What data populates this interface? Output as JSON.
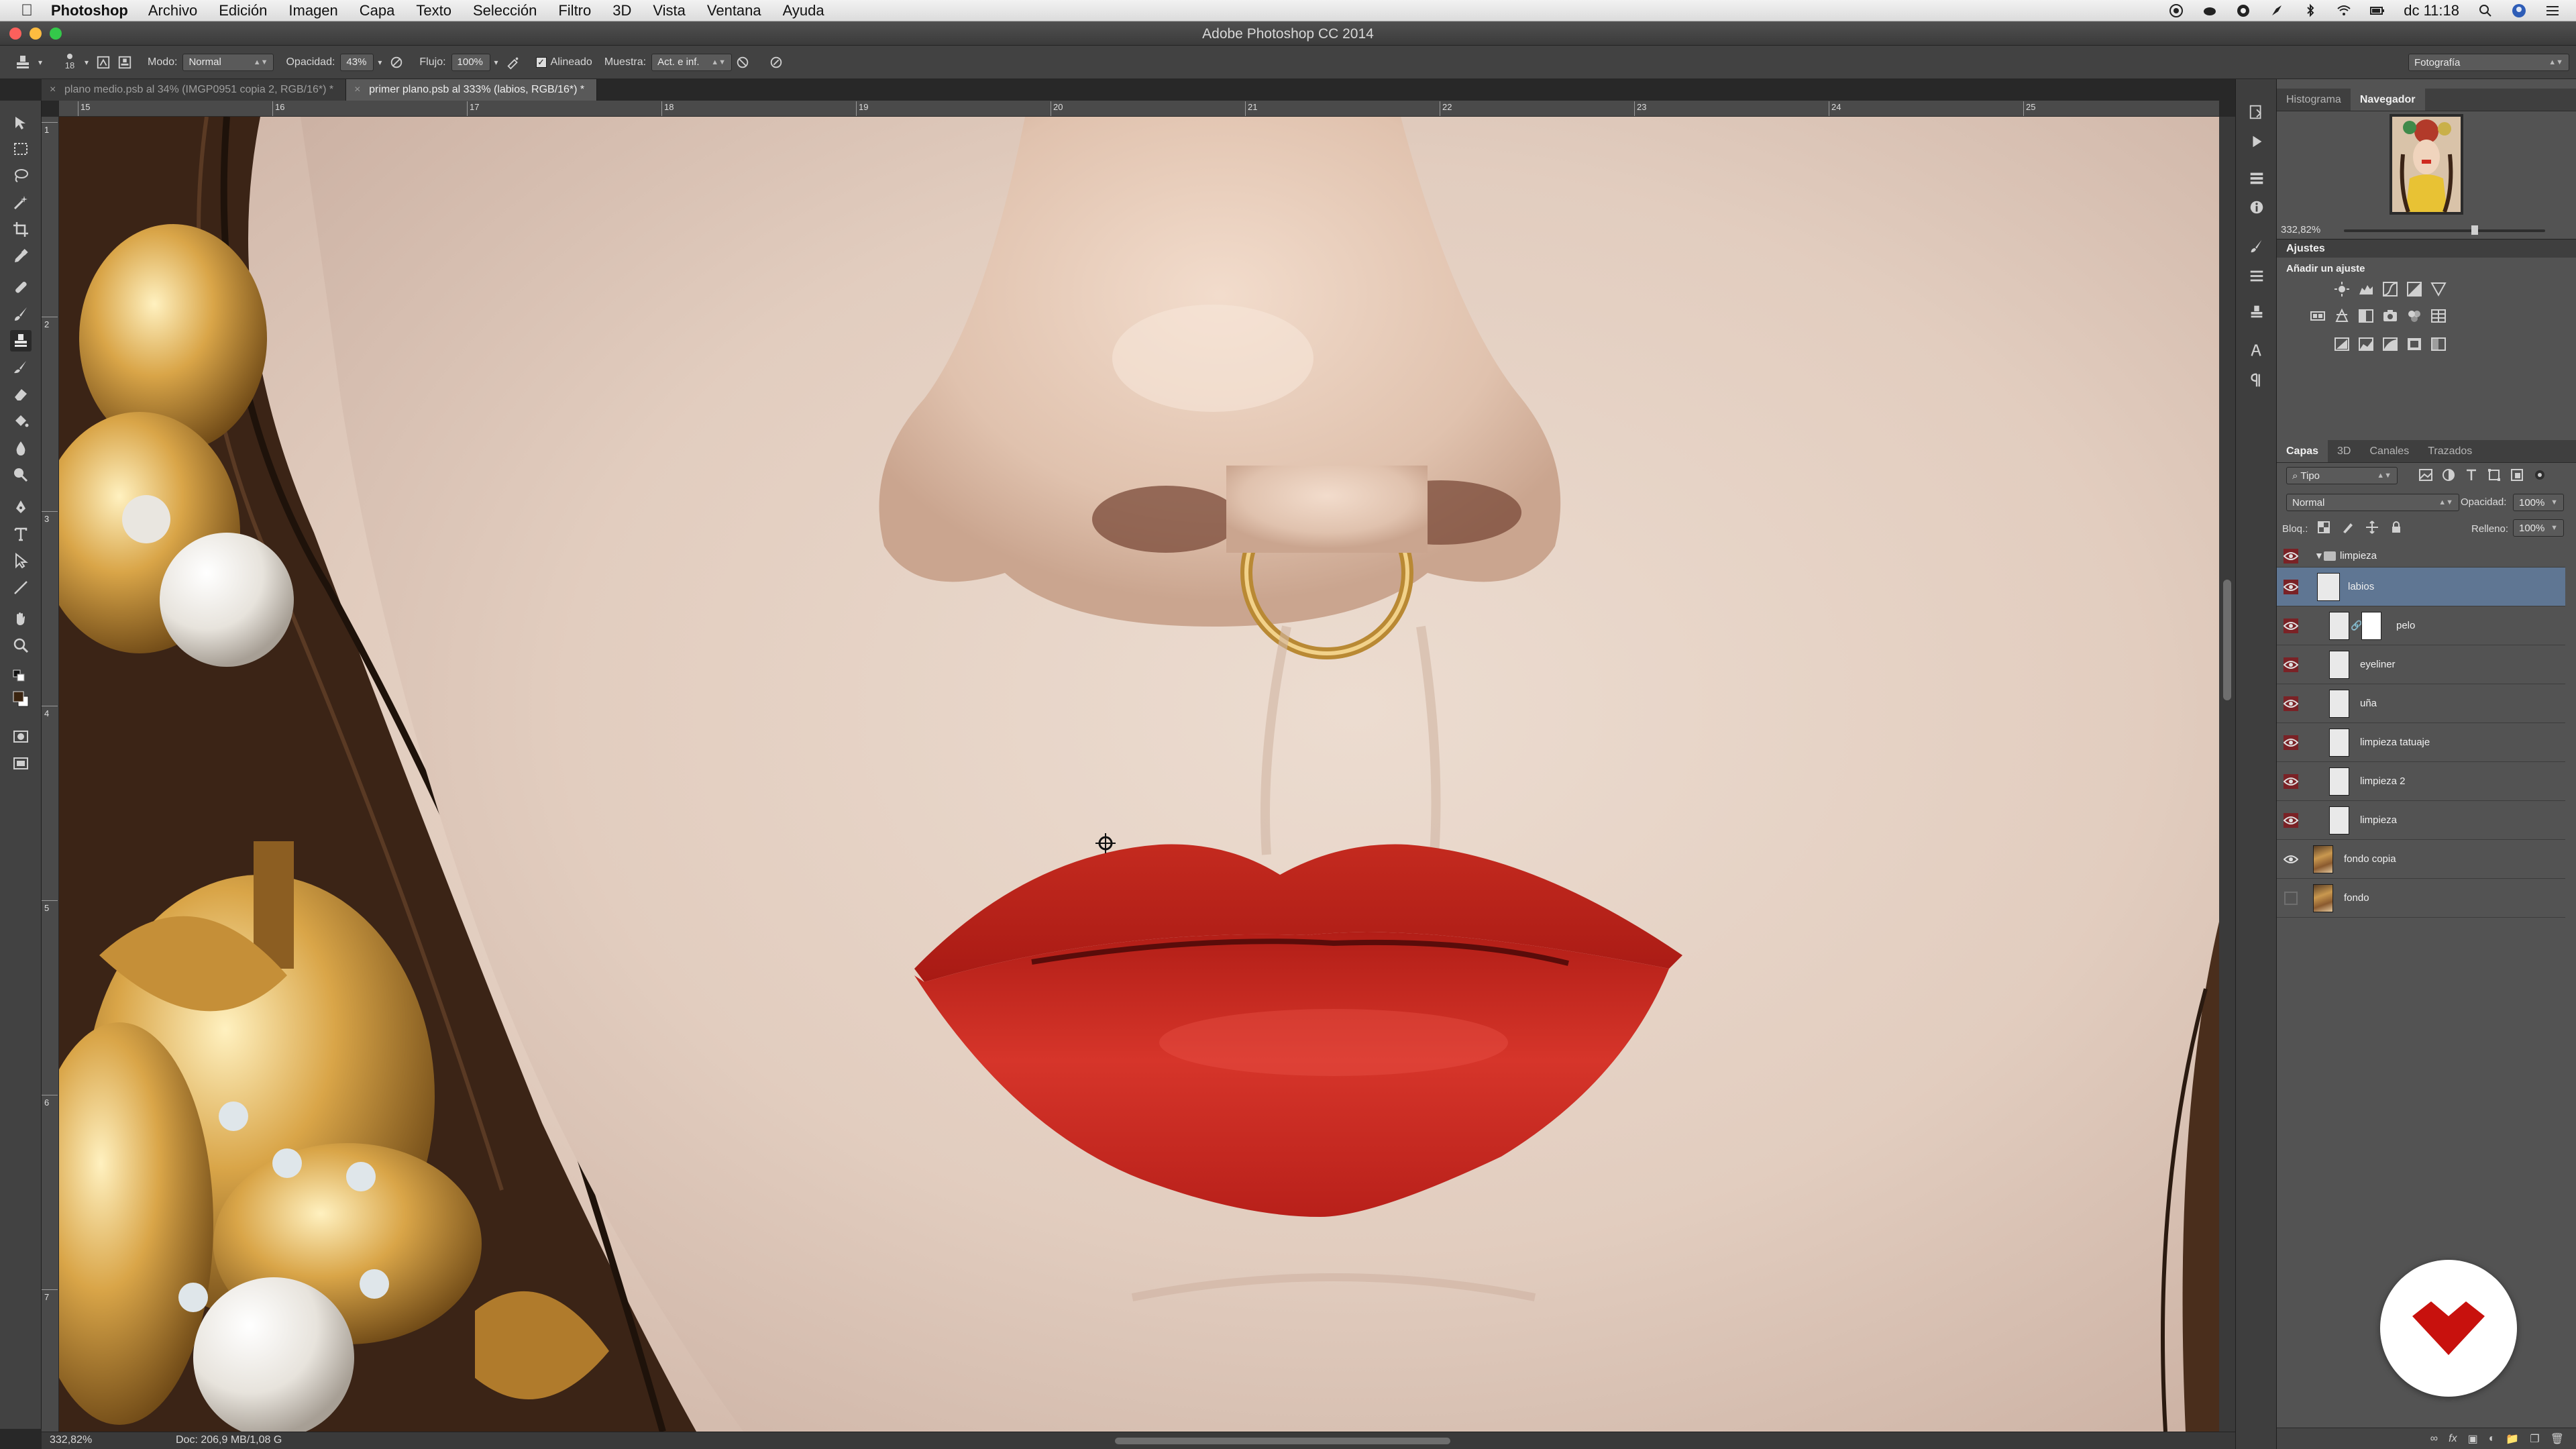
{
  "menubar": {
    "app_name": "Photoshop",
    "items": [
      "Archivo",
      "Edición",
      "Imagen",
      "Capa",
      "Texto",
      "Selección",
      "Filtro",
      "3D",
      "Vista",
      "Ventana",
      "Ayuda"
    ],
    "clock": "dc 11:18"
  },
  "window": {
    "title": "Adobe Photoshop CC 2014"
  },
  "options": {
    "brush_size": "18",
    "mode_label": "Modo:",
    "mode_value": "Normal",
    "opacity_label": "Opacidad:",
    "opacity_value": "43%",
    "flow_label": "Flujo:",
    "flow_value": "100%",
    "aligned_label": "Alineado",
    "aligned_checked": true,
    "sample_label": "Muestra:",
    "sample_value": "Act. e inf.",
    "workspace": "Fotografía"
  },
  "tabs": [
    {
      "label": "plano medio.psb al 34% (IMGP0951 copia 2, RGB/16*) *",
      "active": false
    },
    {
      "label": "primer plano.psb al 333% (labios, RGB/16*) *",
      "active": true
    }
  ],
  "rulers": {
    "horizontal": [
      "15",
      "16",
      "17",
      "18",
      "19",
      "20",
      "21",
      "22",
      "23",
      "24",
      "25"
    ],
    "vertical": [
      "1",
      "2",
      "3",
      "4",
      "5",
      "6",
      "7"
    ]
  },
  "status": {
    "zoom": "332,82%",
    "doc": "Doc: 206,9 MB/1,08 G"
  },
  "panels": {
    "top_tabs": [
      "Histograma",
      "Navegador"
    ],
    "top_active": "Navegador",
    "navigator_zoom": "332,82%",
    "adjustments_title": "Ajustes",
    "adjustments_add": "Añadir un ajuste",
    "layers_tabs": [
      "Capas",
      "3D",
      "Canales",
      "Trazados"
    ],
    "layers_active": "Capas",
    "kind_filter": "Tipo",
    "blend_mode": "Normal",
    "opacity_label": "Opacidad:",
    "opacity_value": "100%",
    "lock_label": "Bloq.:",
    "fill_label": "Relleno:",
    "fill_value": "100%"
  },
  "layers": [
    {
      "name": "limpieza",
      "type": "group",
      "visible": true
    },
    {
      "name": "labios",
      "type": "layer",
      "visible": true,
      "selected": true
    },
    {
      "name": "pelo",
      "type": "layer-mask",
      "visible": true
    },
    {
      "name": "eyeliner",
      "type": "layer",
      "visible": true
    },
    {
      "name": "uña",
      "type": "layer",
      "visible": true
    },
    {
      "name": "limpieza tatuaje",
      "type": "layer",
      "visible": true
    },
    {
      "name": "limpieza 2",
      "type": "layer",
      "visible": true
    },
    {
      "name": "limpieza",
      "type": "layer",
      "visible": true
    },
    {
      "name": "fondo copia",
      "type": "photo",
      "visible": true
    },
    {
      "name": "fondo",
      "type": "photo",
      "visible": false
    }
  ],
  "icons": {
    "clone-stamp-tool": "stamp-icon",
    "eye": "eye-icon",
    "folder": "folder-icon",
    "watermark": "logo-icon"
  },
  "colors": {
    "lip_red": "#c8231c",
    "selection_blue": "#5f7693",
    "panel_bg": "#535353",
    "close_light": "#fc605c",
    "min_light": "#fdbc40",
    "max_light": "#34c84a"
  }
}
